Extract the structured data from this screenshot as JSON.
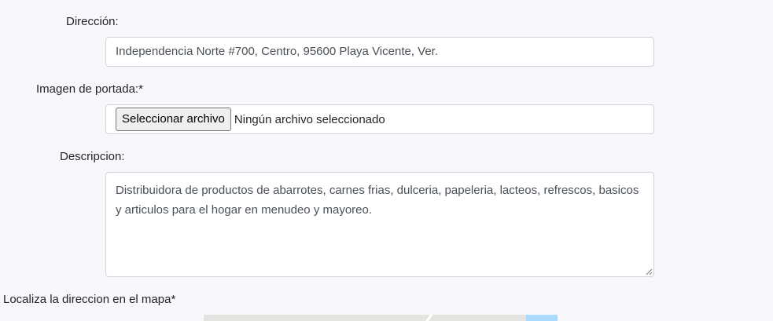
{
  "form": {
    "direccion": {
      "label": "Dirección:",
      "value": "Independencia Norte #700, Centro, 95600 Playa Vicente, Ver."
    },
    "imagen_portada": {
      "label": "Imagen de portada:*",
      "button_label": "Seleccionar archivo",
      "status": "Ningún archivo seleccionado"
    },
    "descripcion": {
      "label": "Descripcion:",
      "value": "Distribuidora de productos de abarrotes, carnes frias, dulceria, papeleria, lacteos, refrescos, basicos y articulos para el hogar en menudeo y mayoreo."
    },
    "mapa": {
      "label": "Localiza la direccion en el mapa*"
    }
  }
}
